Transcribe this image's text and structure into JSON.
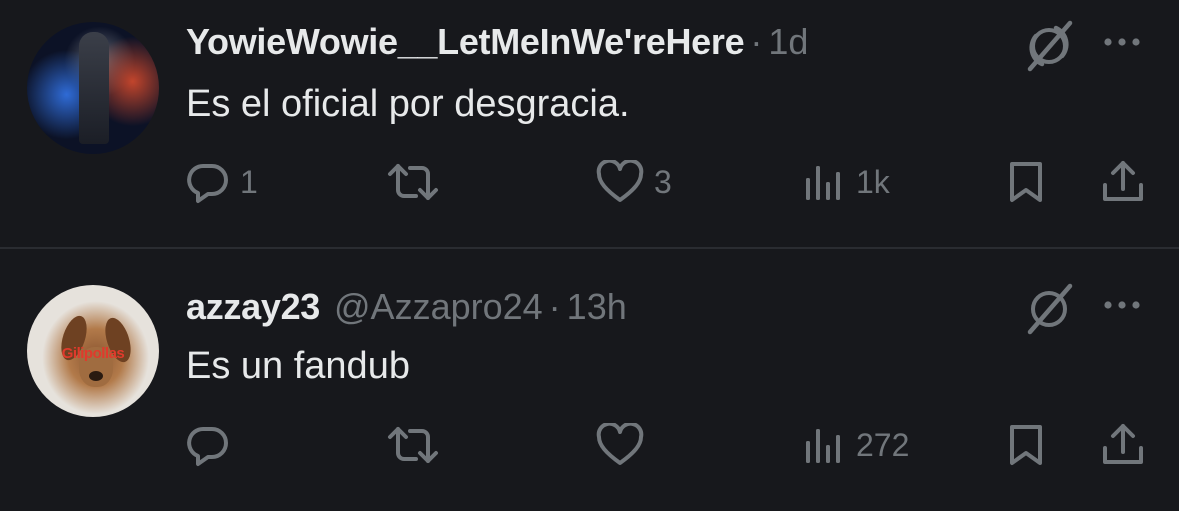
{
  "tweets": [
    {
      "display_name": "YowieWowie__LetMeInWe'reHere",
      "handle": "",
      "separator": "·",
      "time": "1d",
      "text": "Es el oficial por desgracia.",
      "avatar_overlay": "",
      "stats": {
        "replies": "1",
        "reposts": "",
        "likes": "3",
        "views": "1k"
      }
    },
    {
      "display_name": "azzay23",
      "handle": "@Azzapro24",
      "separator": "·",
      "time": "13h",
      "text": "Es un fandub",
      "avatar_overlay": "Gilipollas",
      "stats": {
        "replies": "",
        "reposts": "",
        "likes": "",
        "views": "272"
      }
    }
  ],
  "icons": {
    "grok": "grok-icon",
    "more": "more-icon",
    "reply": "reply-icon",
    "repost": "repost-icon",
    "like": "like-icon",
    "views": "views-icon",
    "bookmark": "bookmark-icon",
    "share": "share-icon"
  },
  "colors": {
    "background": "#17181c",
    "primary_text": "#e7e9ea",
    "secondary_text": "#71767b",
    "divider": "#2a2c31"
  }
}
